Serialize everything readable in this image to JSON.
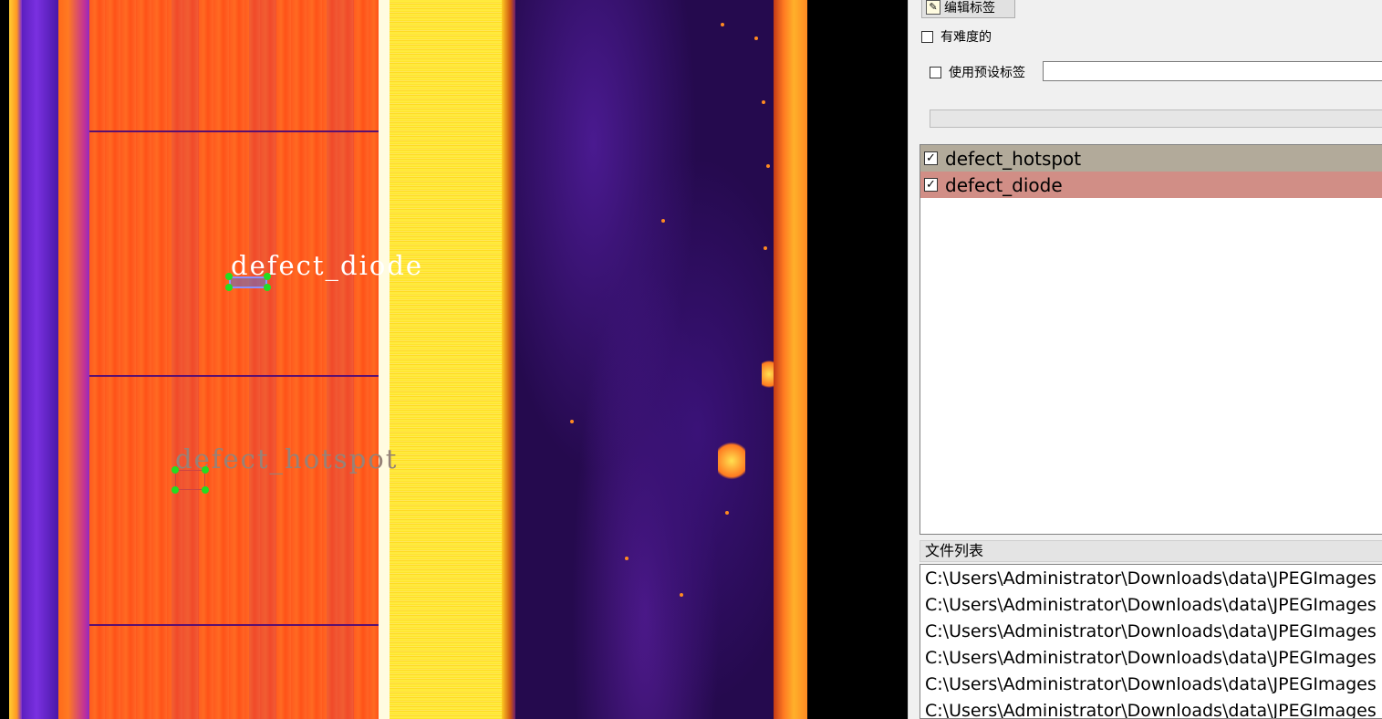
{
  "canvas": {
    "annotations": [
      {
        "label": "defect_diode",
        "color": "#ffffff"
      },
      {
        "label": "defect_hotspot",
        "color": "#968278"
      }
    ]
  },
  "sidebar": {
    "edit_label_button": "编辑标签",
    "difficult_checkbox": {
      "label": "有难度的",
      "checked": false
    },
    "preset_label_checkbox": {
      "label": "使用预设标签",
      "checked": false
    },
    "preset_label_input": {
      "value": ""
    },
    "label_list": [
      {
        "label": "defect_hotspot",
        "checked": true,
        "color": "#b2aa9a"
      },
      {
        "label": "defect_diode",
        "checked": true,
        "color": "#d18e86"
      }
    ],
    "file_list_title": "文件列表",
    "file_list": [
      "C:\\Users\\Administrator\\Downloads\\data\\JPEGImages",
      "C:\\Users\\Administrator\\Downloads\\data\\JPEGImages",
      "C:\\Users\\Administrator\\Downloads\\data\\JPEGImages",
      "C:\\Users\\Administrator\\Downloads\\data\\JPEGImages",
      "C:\\Users\\Administrator\\Downloads\\data\\JPEGImages",
      "C:\\Users\\Administrator\\Downloads\\data\\JPEGImages"
    ]
  }
}
